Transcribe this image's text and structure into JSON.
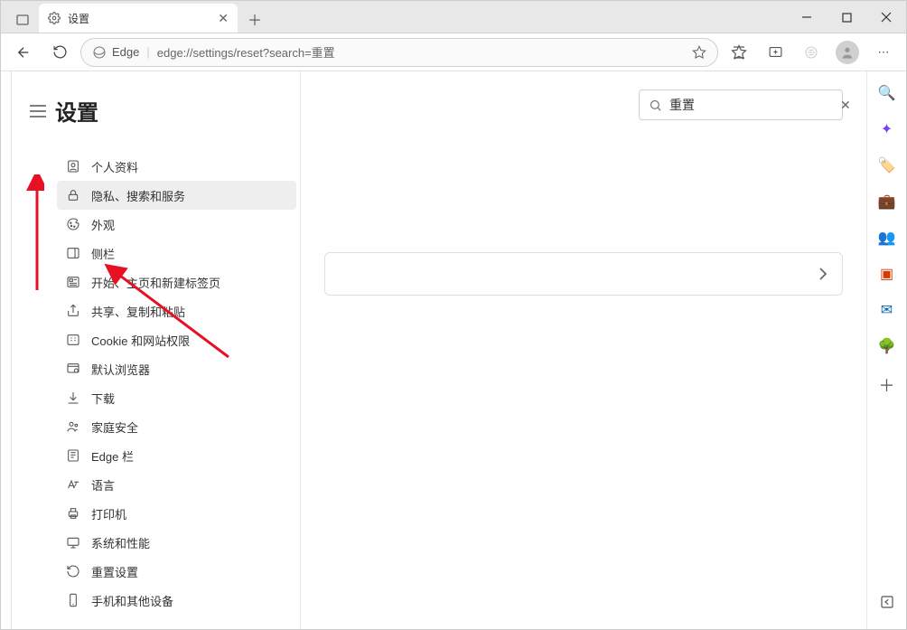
{
  "tab": {
    "title": "设置"
  },
  "address": {
    "brand": "Edge",
    "url": "edge://settings/reset?search=重置"
  },
  "settings": {
    "header": "设置",
    "nav": [
      {
        "label": "个人资料",
        "icon": "profile-icon"
      },
      {
        "label": "隐私、搜索和服务",
        "icon": "lock-icon",
        "active": true
      },
      {
        "label": "外观",
        "icon": "appearance-icon"
      },
      {
        "label": "侧栏",
        "icon": "sidebar-icon"
      },
      {
        "label": "开始、主页和新建标签页",
        "icon": "home-icon"
      },
      {
        "label": "共享、复制和粘贴",
        "icon": "share-icon"
      },
      {
        "label": "Cookie 和网站权限",
        "icon": "cookie-icon"
      },
      {
        "label": "默认浏览器",
        "icon": "browser-icon"
      },
      {
        "label": "下载",
        "icon": "download-icon"
      },
      {
        "label": "家庭安全",
        "icon": "family-icon"
      },
      {
        "label": "Edge 栏",
        "icon": "edgebar-icon"
      },
      {
        "label": "语言",
        "icon": "language-icon"
      },
      {
        "label": "打印机",
        "icon": "printer-icon"
      },
      {
        "label": "系统和性能",
        "icon": "system-icon"
      },
      {
        "label": "重置设置",
        "icon": "reset-icon"
      },
      {
        "label": "手机和其他设备",
        "icon": "phone-icon"
      }
    ]
  },
  "search": {
    "value": "重置"
  },
  "rightbar_icons": [
    "🔍",
    "✦",
    "🏷️",
    "💼",
    "👥",
    "📄",
    "✉️",
    "🌳"
  ]
}
